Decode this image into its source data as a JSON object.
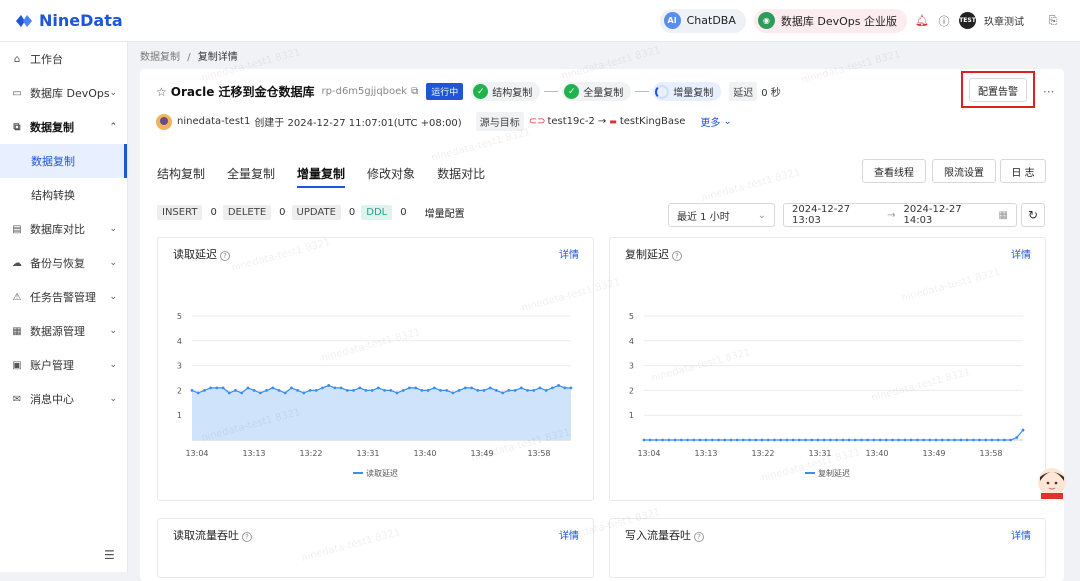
{
  "app": {
    "logo": "NineData"
  },
  "topbar": {
    "chatdba": "ChatDBA",
    "devops": "数据库 DevOps 企业版",
    "user_badge": "TEST",
    "user_name": "玖章测试"
  },
  "sidebar": {
    "items": [
      {
        "label": "工作台",
        "icon": "home-icon"
      },
      {
        "label": "数据库 DevOps",
        "icon": "devops-icon"
      },
      {
        "label": "数据复制",
        "icon": "copy-icon"
      },
      {
        "label": "数据库对比",
        "icon": "compare-icon"
      },
      {
        "label": "备份与恢复",
        "icon": "backup-icon"
      },
      {
        "label": "任务告警管理",
        "icon": "alarm-icon"
      },
      {
        "label": "数据源管理",
        "icon": "datasource-icon"
      },
      {
        "label": "账户管理",
        "icon": "account-icon"
      },
      {
        "label": "消息中心",
        "icon": "mail-icon"
      }
    ],
    "subitems": [
      "数据复制",
      "结构转换"
    ]
  },
  "breadcrumb": {
    "parent": "数据复制",
    "sep": "/",
    "current": "复制详情"
  },
  "task": {
    "title": "Oracle 迁移到金仓数据库",
    "id": "rp-d6m5gjjqboek",
    "status": "运行中",
    "steps": [
      "结构复制",
      "全量复制",
      "增量复制"
    ],
    "delay": "延迟",
    "delay_value": "0 秒",
    "owner": "ninedata-test1",
    "created": "创建于 2024-12-27 11:07:01(UTC +08:00)",
    "src_tag": "源与目标",
    "source": "test19c-2",
    "arrow": "→",
    "target": "testKingBase",
    "more": "更多"
  },
  "buttons": {
    "alert": "配置告警",
    "threads": "查看线程",
    "limit": "限流设置",
    "log": "日 志"
  },
  "tabs": [
    "结构复制",
    "全量复制",
    "增量复制",
    "修改对象",
    "数据对比"
  ],
  "counts": [
    {
      "k": "INSERT",
      "v": "0"
    },
    {
      "k": "DELETE",
      "v": "0"
    },
    {
      "k": "UPDATE",
      "v": "0"
    },
    {
      "k": "DDL",
      "v": "0"
    }
  ],
  "incr_config": "增量配置",
  "time_select": "最近 1 小时",
  "date_start": "2024-12-27 13:03",
  "date_arrow": "→",
  "date_end": "2024-12-27 14:03",
  "detail_label": "详情",
  "watermark": "ninedata-test1 8321",
  "chart_data": [
    {
      "type": "area",
      "title": "读取延迟",
      "legend": "读取延迟",
      "ylim": [
        0,
        5
      ],
      "yticks": [
        1,
        2,
        3,
        4,
        5
      ],
      "xticks": [
        "13:04",
        "13:13",
        "13:22",
        "13:31",
        "13:40",
        "13:49",
        "13:58"
      ],
      "values": [
        2.0,
        1.9,
        2.0,
        2.1,
        2.1,
        2.1,
        1.9,
        2.0,
        1.9,
        2.1,
        2.0,
        1.9,
        2.0,
        2.1,
        2.0,
        1.9,
        2.1,
        2.0,
        1.9,
        2.0,
        2.0,
        2.1,
        2.2,
        2.1,
        2.1,
        2.0,
        2.0,
        2.1,
        2.0,
        2.0,
        2.1,
        2.0,
        2.0,
        1.9,
        2.0,
        2.1,
        2.1,
        2.0,
        2.0,
        2.1,
        2.0,
        2.0,
        1.9,
        2.0,
        2.1,
        2.1,
        2.0,
        2.0,
        2.1,
        2.0,
        1.9,
        2.0,
        2.0,
        2.1,
        2.0,
        2.0,
        2.1,
        2.0,
        2.1,
        2.2,
        2.1,
        2.1
      ]
    },
    {
      "type": "line",
      "title": "复制延迟",
      "legend": "复制延迟",
      "ylim": [
        0,
        5
      ],
      "yticks": [
        1,
        2,
        3,
        4,
        5
      ],
      "xticks": [
        "13:04",
        "13:13",
        "13:22",
        "13:31",
        "13:40",
        "13:49",
        "13:58"
      ],
      "values": [
        0,
        0,
        0,
        0,
        0,
        0,
        0,
        0,
        0,
        0,
        0,
        0,
        0,
        0,
        0,
        0,
        0,
        0,
        0,
        0,
        0,
        0,
        0,
        0,
        0,
        0,
        0,
        0,
        0,
        0,
        0,
        0,
        0,
        0,
        0,
        0,
        0,
        0,
        0,
        0,
        0,
        0,
        0,
        0,
        0,
        0,
        0,
        0,
        0,
        0,
        0,
        0,
        0,
        0,
        0,
        0,
        0,
        0,
        0,
        0,
        0.1,
        0.4
      ]
    },
    {
      "title": "读取流量吞吐"
    },
    {
      "title": "写入流量吞吐"
    }
  ]
}
